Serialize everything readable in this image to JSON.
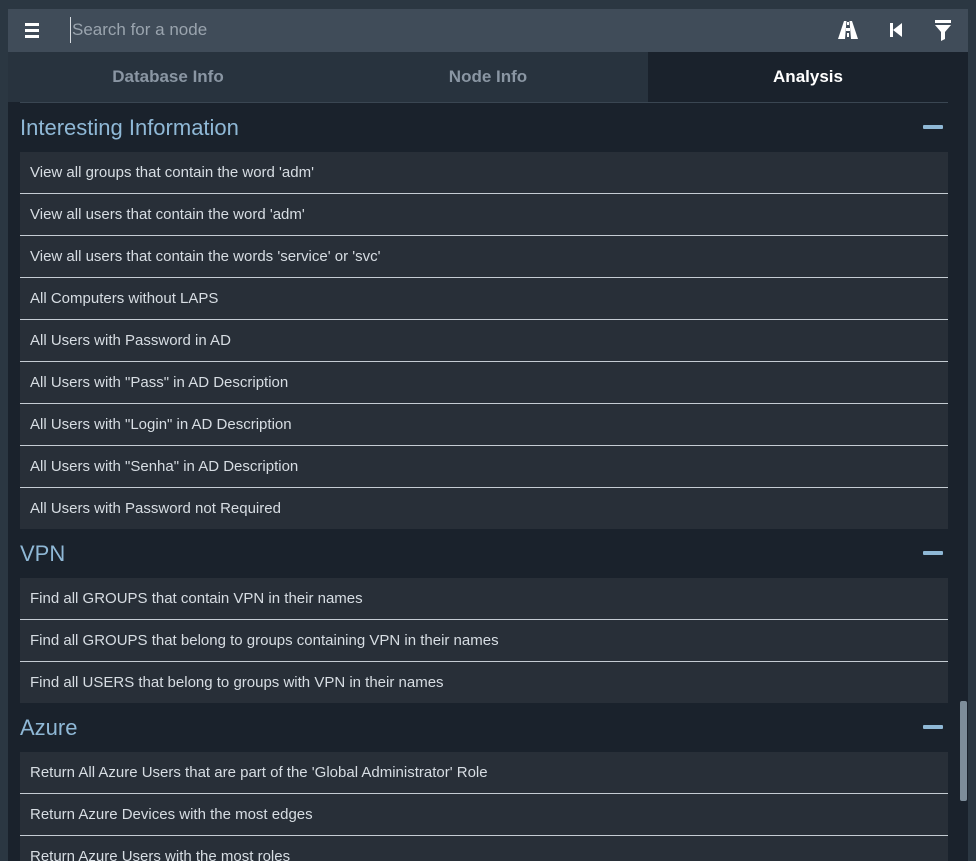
{
  "search": {
    "placeholder": "Search for a node"
  },
  "toolbar": {
    "icons": [
      "menu-icon",
      "pathfinding-icon",
      "back-icon",
      "filter-icon"
    ]
  },
  "tabs": [
    {
      "label": "Database Info",
      "active": false
    },
    {
      "label": "Node Info",
      "active": false
    },
    {
      "label": "Analysis",
      "active": true
    }
  ],
  "sections": [
    {
      "title": "Interesting Information",
      "queries": [
        "View all groups that contain the word 'adm'",
        "View all users that contain the word 'adm'",
        "View all users that contain the words 'service' or 'svc'",
        "All Computers without LAPS",
        "All Users with Password in AD",
        "All Users with \"Pass\" in AD Description",
        "All Users with \"Login\" in AD Description",
        "All Users with \"Senha\" in AD Description",
        "All Users with Password not Required"
      ]
    },
    {
      "title": "VPN",
      "queries": [
        "Find all GROUPS that contain VPN in their names",
        "Find all GROUPS that belong to groups containing VPN in their names",
        "Find all USERS that belong to groups with VPN in their names"
      ]
    },
    {
      "title": "Azure",
      "queries": [
        "Return All Azure Users that are part of the 'Global Administrator' Role",
        "Return Azure Devices with the most edges",
        "Return Azure Users with the most roles"
      ]
    }
  ],
  "colors": {
    "accent": "#8fb8d6",
    "panel": "#1a222c",
    "item": "#282f38"
  }
}
